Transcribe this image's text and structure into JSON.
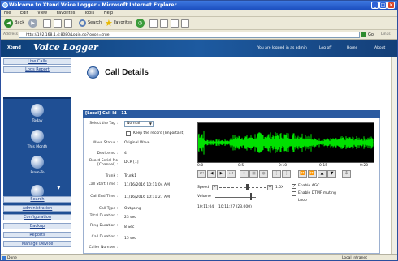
{
  "window": {
    "title": "Welcome to Xtend Voice Logger - Microsoft Internet Explorer",
    "min": "_",
    "max": "□",
    "close": "×"
  },
  "menu": [
    "File",
    "Edit",
    "View",
    "Favorites",
    "Tools",
    "Help"
  ],
  "toolbar": {
    "back": "Back",
    "search": "Search",
    "favorites": "Favorites"
  },
  "address": {
    "label": "Address",
    "url": "http://192.168.1.4:8080/Login.do?logon=true",
    "go": "Go",
    "links": "Links"
  },
  "banner": {
    "logo": "Xtend",
    "title": "Voice Logger",
    "logged_in": "You are logged in as admin",
    "logoff": "Log off",
    "home": "Home",
    "about": "About"
  },
  "nav_top": [
    "Live Calls",
    "Logs Report"
  ],
  "nav_icons": [
    {
      "label": "Today",
      "icon": "calendar-icon"
    },
    {
      "label": "This Month",
      "icon": "calendar-icon"
    },
    {
      "label": "From-To",
      "icon": "calendar-icon"
    },
    {
      "label": "",
      "icon": "calendar-icon"
    }
  ],
  "nav_bottom": [
    "Search",
    "Administration",
    "Configuration",
    "Backup",
    "Reports",
    "Manage Device"
  ],
  "page": {
    "title": "Call Details",
    "panel_header": "[Local] Call Id - 11",
    "select_tag_label": "Select the Tag :",
    "select_tag_value": "Normal",
    "keep_record": "Keep the record [Important]",
    "wave_status_label": "Wave Status :",
    "wave_status": "Original Wave",
    "device_no_label": "Device no :",
    "device_no": "4",
    "board_label": "Board Serial No [Channel] :",
    "board": "DCR [1]",
    "trunk_label": "Trunk :",
    "trunk": "Trunk1",
    "start_label": "Call Start Time :",
    "start": "11/16/2016 10:11:04 AM",
    "end_label": "Call End Time :",
    "end": "11/16/2016 10:11:27 AM",
    "type_label": "Call Type :",
    "type": "Outgoing",
    "total_label": "Total Duration :",
    "total": "23 sec",
    "ring_label": "Ring Duration :",
    "ring": "8 Sec",
    "call_dur_label": "Call Duration :",
    "call_dur": "15 sec",
    "caller_label": "Caller Number :"
  },
  "player": {
    "ticks": [
      "0:0",
      "0:5",
      "0:10",
      "0:15",
      "0:20"
    ],
    "speed_label": "Speed",
    "speed_value": "1.0X",
    "volume_label": "Volume",
    "time_start": "10:11:04",
    "time_end": "10:11:27 (23.000)",
    "enable_agc": "Enable AGC",
    "enable_dtmf": "Enable DTMF muting",
    "loop": "Loop",
    "agc_checked": true
  },
  "status": {
    "left": "Done",
    "right": "Local intranet"
  },
  "colors": {
    "banner": "#1d5aa0",
    "panel_header": "#2a5aa0",
    "wave": "#00e000"
  }
}
